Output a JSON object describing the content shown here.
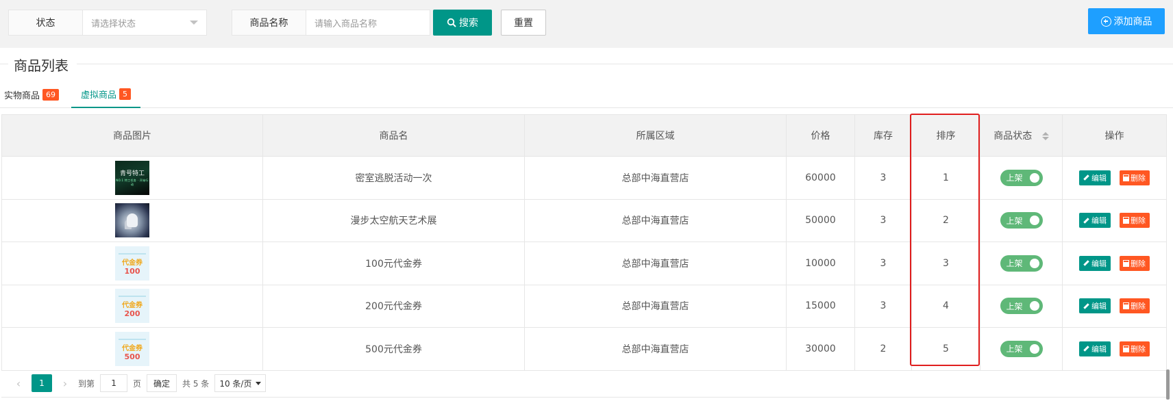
{
  "filters": {
    "status_label": "状态",
    "status_placeholder": "请选择状态",
    "name_label": "商品名称",
    "name_placeholder": "请输入商品名称",
    "search_label": "搜索",
    "reset_label": "重置",
    "add_label": "添加商品"
  },
  "section_title": "商品列表",
  "tabs": [
    {
      "label": "实物商品",
      "count": "69"
    },
    {
      "label": "虚拟商品",
      "count": "5"
    }
  ],
  "table": {
    "headers": [
      "商品图片",
      "商品名",
      "所属区域",
      "价格",
      "库存",
      "排序",
      "商品状态",
      "操作"
    ],
    "rows": [
      {
        "name": "密室逃脱活动一次",
        "region": "总部中海直营店",
        "price": "60000",
        "stock": "3",
        "sort": "1",
        "status": "上架",
        "thumb_text": "青号特工",
        "thumb_sub": "NO.1 特工任务 · 开始行动"
      },
      {
        "name": "漫步太空航天艺术展",
        "region": "总部中海直营店",
        "price": "50000",
        "stock": "3",
        "sort": "2",
        "status": "上架"
      },
      {
        "name": "100元代金券",
        "region": "总部中海直营店",
        "price": "10000",
        "stock": "3",
        "sort": "3",
        "status": "上架",
        "thumb_text": "代金券",
        "thumb_amount": "100"
      },
      {
        "name": "200元代金券",
        "region": "总部中海直营店",
        "price": "15000",
        "stock": "3",
        "sort": "4",
        "status": "上架",
        "thumb_text": "代金券",
        "thumb_amount": "200"
      },
      {
        "name": "500元代金券",
        "region": "总部中海直营店",
        "price": "30000",
        "stock": "2",
        "sort": "5",
        "status": "上架",
        "thumb_text": "代金券",
        "thumb_amount": "500"
      }
    ],
    "edit_label": "编辑",
    "delete_label": "删除"
  },
  "pagination": {
    "current_page": "1",
    "goto_label": "到第",
    "goto_value": "1",
    "page_unit": "页",
    "confirm_label": "确定",
    "total_label": "共 5 条",
    "page_size_label": "10 条/页"
  },
  "colors": {
    "primary": "#009688",
    "add_blue": "#1e9fff",
    "danger": "#ff5722",
    "switch_on": "#5fb878",
    "highlight_box": "#e01e1e"
  }
}
